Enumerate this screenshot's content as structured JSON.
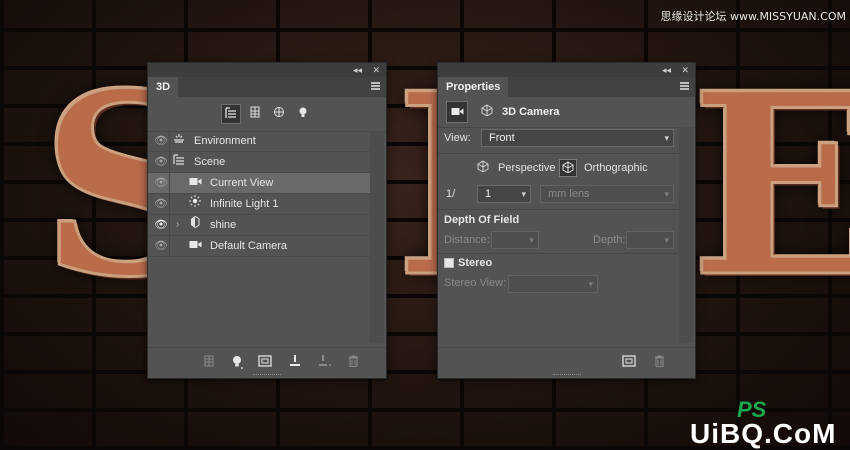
{
  "background": {
    "letters": [
      "S",
      "E",
      "E"
    ]
  },
  "watermarks": {
    "top": "思缘设计论坛 www.MISSYUAN.COM",
    "ps": "PS",
    "site": "UiBQ.CoM"
  },
  "panel3d": {
    "tab": "3D",
    "collapse": "◂◂",
    "close": "✕",
    "filters": [
      "whole-scene",
      "meshes",
      "materials",
      "lights"
    ],
    "layers": [
      {
        "name": "Environment",
        "icon": "environment-icon",
        "visible": true
      },
      {
        "name": "Scene",
        "icon": "scene-icon",
        "visible": true
      },
      {
        "name": "Current View",
        "icon": "camera-icon",
        "visible": true,
        "selected": true
      },
      {
        "name": "Infinite Light 1",
        "icon": "light-icon",
        "visible": true
      },
      {
        "name": "shine",
        "icon": "mesh-icon",
        "visible": true,
        "expandable": true
      },
      {
        "name": "Default Camera",
        "icon": "camera-icon",
        "visible": true
      }
    ],
    "footer": [
      "new-mesh-icon",
      "add-light-icon",
      "render-icon",
      "drop-to-plane-icon",
      "new-constraint-icon",
      "delete-icon"
    ]
  },
  "properties": {
    "tab": "Properties",
    "collapse": "◂◂",
    "close": "✕",
    "title": "3D Camera",
    "view_label": "View:",
    "view_value": "Front",
    "perspective_label": "Perspective",
    "orthographic_label": "Orthographic",
    "zoom_prefix": "1/",
    "zoom_value": "1",
    "lens_value": "mm lens",
    "dof_title": "Depth Of Field",
    "distance_label": "Distance:",
    "depth_label": "Depth:",
    "stereo_label": "Stereo",
    "stereo_view_label": "Stereo View:",
    "footer": [
      "render-icon",
      "delete-icon"
    ]
  }
}
